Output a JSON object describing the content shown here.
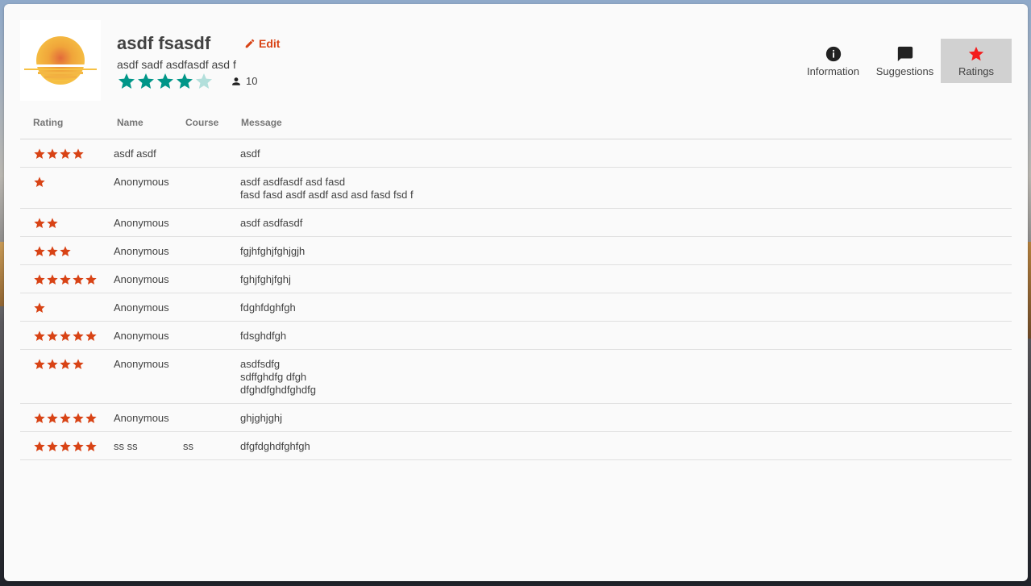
{
  "profile": {
    "name": "asdf fsasdf",
    "edit_label": "Edit",
    "subtitle": "asdf sadf asdfasdf asd f",
    "average_rating": 4,
    "max_rating": 5,
    "rating_count": "10"
  },
  "tabs": [
    {
      "label": "Information",
      "icon": "info-icon",
      "active": false
    },
    {
      "label": "Suggestions",
      "icon": "chat-icon",
      "active": false
    },
    {
      "label": "Ratings",
      "icon": "star-icon",
      "active": true
    }
  ],
  "table": {
    "headers": {
      "rating": "Rating",
      "name": "Name",
      "course": "Course",
      "message": "Message"
    },
    "rows": [
      {
        "rating": 4,
        "name": "asdf asdf",
        "course": "",
        "message": [
          "asdf"
        ]
      },
      {
        "rating": 1,
        "name": "Anonymous",
        "course": "",
        "message": [
          "asdf asdfasdf asd fasd",
          "fasd fasd asdf asdf asd asd fasd fsd f"
        ]
      },
      {
        "rating": 2,
        "name": "Anonymous",
        "course": "",
        "message": [
          "asdf asdfasdf"
        ]
      },
      {
        "rating": 3,
        "name": "Anonymous",
        "course": "",
        "message": [
          "fgjhfghjfghjgjh"
        ]
      },
      {
        "rating": 5,
        "name": "Anonymous",
        "course": "",
        "message": [
          "fghjfghjfghj"
        ]
      },
      {
        "rating": 1,
        "name": "Anonymous",
        "course": "",
        "message": [
          "fdghfdghfgh"
        ]
      },
      {
        "rating": 5,
        "name": "Anonymous",
        "course": "",
        "message": [
          "fdsghdfgh"
        ]
      },
      {
        "rating": 4,
        "name": "Anonymous",
        "course": "",
        "message": [
          "asdfsdfg",
          "sdffghdfg dfgh",
          "dfghdfghdfghdfg"
        ]
      },
      {
        "rating": 5,
        "name": "Anonymous",
        "course": "",
        "message": [
          "ghjghjghj"
        ]
      },
      {
        "rating": 5,
        "name": "ss ss",
        "course": "ss",
        "message": [
          "dfgfdghdfghfgh"
        ]
      }
    ]
  },
  "colors": {
    "accent": "#d84315",
    "teal_star": "#009688",
    "teal_star_empty": "#b2dfdb",
    "active_tab_star": "#f41c1c"
  }
}
